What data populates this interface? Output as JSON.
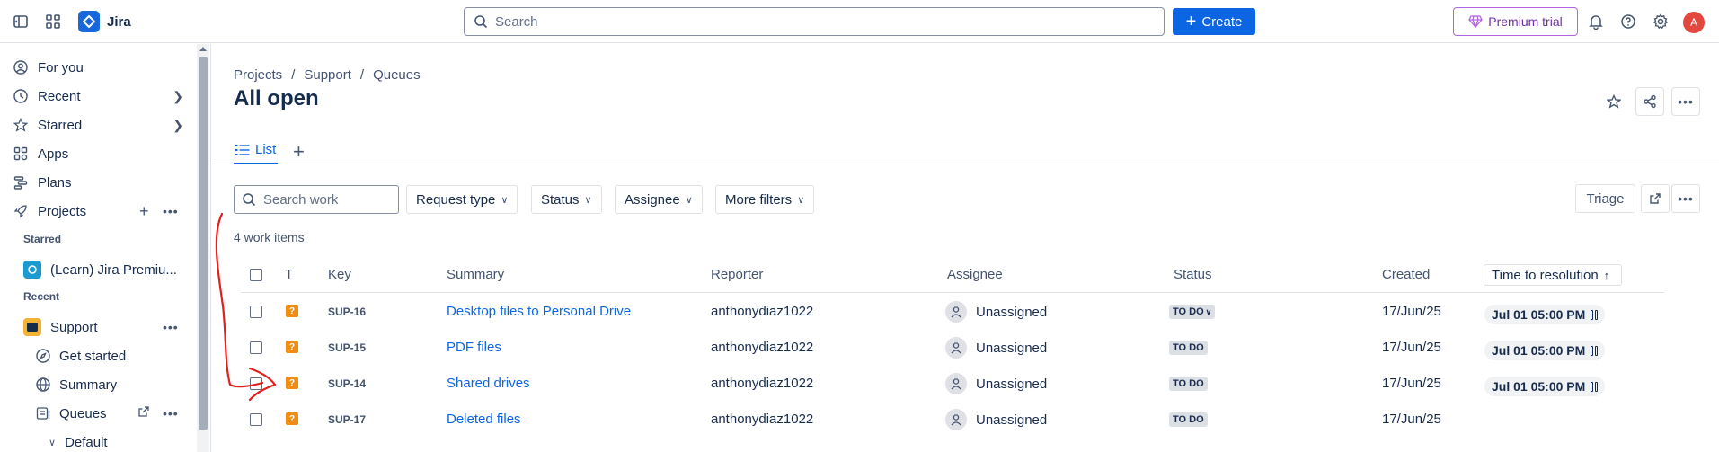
{
  "topbar": {
    "app_name": "Jira",
    "search_placeholder": "Search",
    "create_label": "Create",
    "premium_label": "Premium trial",
    "avatar_initial": "A"
  },
  "sidebar": {
    "for_you": "For you",
    "recent": "Recent",
    "starred": "Starred",
    "apps": "Apps",
    "plans": "Plans",
    "projects": "Projects",
    "starred_heading": "Starred",
    "starred_project": "(Learn) Jira Premiu...",
    "recent_heading": "Recent",
    "recent_project": "Support",
    "get_started": "Get started",
    "summary": "Summary",
    "queues": "Queues",
    "default": "Default"
  },
  "breadcrumb": [
    "Projects",
    "Support",
    "Queues"
  ],
  "page_title": "All open",
  "tabs": {
    "list": "List"
  },
  "filters": {
    "search_placeholder": "Search work",
    "request_type": "Request type",
    "status": "Status",
    "assignee": "Assignee",
    "more_filters": "More filters",
    "triage": "Triage"
  },
  "count_text": "4 work items",
  "columns": {
    "type": "T",
    "key": "Key",
    "summary": "Summary",
    "reporter": "Reporter",
    "assignee": "Assignee",
    "status": "Status",
    "created": "Created",
    "time_to_resolution": "Time to resolution"
  },
  "rows": [
    {
      "key": "SUP-16",
      "summary": "Desktop files to Personal Drive",
      "reporter": "anthonydiaz1022",
      "assignee": "Unassigned",
      "status": "TO DO",
      "created": "17/Jun/25",
      "ttr": "Jul 01 05:00 PM"
    },
    {
      "key": "SUP-15",
      "summary": "PDF files",
      "reporter": "anthonydiaz1022",
      "assignee": "Unassigned",
      "status": "TO DO",
      "created": "17/Jun/25",
      "ttr": "Jul 01 05:00 PM"
    },
    {
      "key": "SUP-14",
      "summary": "Shared drives",
      "reporter": "anthonydiaz1022",
      "assignee": "Unassigned",
      "status": "TO DO",
      "created": "17/Jun/25",
      "ttr": "Jul 01 05:00 PM"
    },
    {
      "key": "SUP-17",
      "summary": "Deleted files",
      "reporter": "anthonydiaz1022",
      "assignee": "Unassigned",
      "status": "TO DO",
      "created": "17/Jun/25",
      "ttr": ""
    }
  ],
  "colors": {
    "brand_blue": "#0c66e4",
    "premium_purple": "#b265e0",
    "type_orange": "#f18d13",
    "avatar_red": "#e2483d",
    "annotation_red": "#e0201b"
  }
}
